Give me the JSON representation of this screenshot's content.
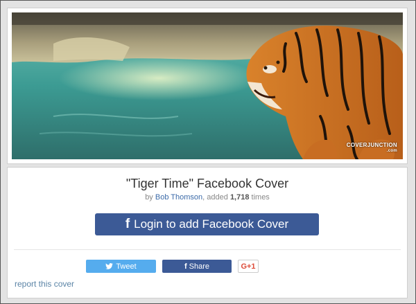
{
  "cover": {
    "title": "\"Tiger Time\" Facebook Cover",
    "byline_prefix": "by ",
    "author": "Bob Thomson",
    "added_prefix": ", added ",
    "count": "1,718",
    "added_suffix": " times",
    "watermark": "COVERJUNCTION",
    "watermark_sub": ".com"
  },
  "actions": {
    "login_icon": "f",
    "login_label": "Login to add Facebook Cover",
    "tweet_icon": "twitter-bird-icon",
    "tweet_label": "Tweet",
    "share_icon": "f",
    "share_label": "Share",
    "gplus_label": "G+1",
    "report_label": "report this cover"
  },
  "colors": {
    "facebook_blue": "#3c5a96",
    "twitter_blue": "#55acee",
    "gplus_red": "#dd4b39",
    "link": "#3b6aa8"
  }
}
